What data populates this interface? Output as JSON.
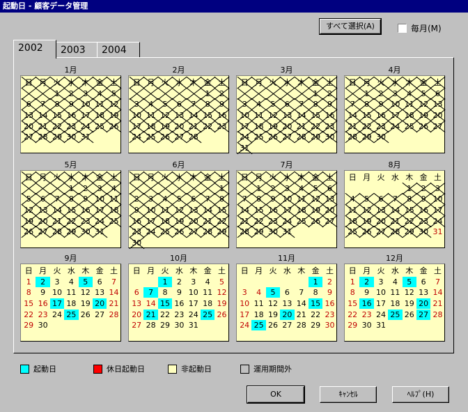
{
  "window": {
    "title": "起動日 - 顧客データ管理"
  },
  "toolbar": {
    "select_all_label": "すべて選択(A)",
    "monthly_label": "毎月(M)"
  },
  "tabs": [
    "2002",
    "2003",
    "2004"
  ],
  "active_tab": "2002",
  "weekday_headers": [
    "日",
    "月",
    "火",
    "水",
    "木",
    "金",
    "土"
  ],
  "months": [
    {
      "title": "1月",
      "start": 2,
      "days": 31,
      "off": true
    },
    {
      "title": "2月",
      "start": 5,
      "days": 28,
      "off": true
    },
    {
      "title": "3月",
      "start": 5,
      "days": 31,
      "off": true
    },
    {
      "title": "4月",
      "start": 1,
      "days": 30,
      "off": true
    },
    {
      "title": "5月",
      "start": 3,
      "days": 31,
      "off": true
    },
    {
      "title": "6月",
      "start": 6,
      "days": 30,
      "off": true
    },
    {
      "title": "7月",
      "start": 1,
      "days": 31,
      "off": true
    },
    {
      "title": "8月",
      "start": 4,
      "days": 31,
      "off_through": 30,
      "holidays": []
    },
    {
      "title": "9月",
      "start": 0,
      "days": 30,
      "cyan": [
        2,
        5,
        17,
        20,
        25
      ],
      "holidays": [
        16,
        23
      ]
    },
    {
      "title": "10月",
      "start": 2,
      "days": 31,
      "cyan": [
        1,
        7,
        15,
        21,
        25
      ],
      "holidays": [
        14
      ]
    },
    {
      "title": "11月",
      "start": 5,
      "days": 30,
      "cyan": [
        1,
        5,
        15,
        20,
        25
      ],
      "holidays": [
        3,
        4,
        23
      ]
    },
    {
      "title": "12月",
      "start": 0,
      "days": 31,
      "cyan": [
        2,
        5,
        16,
        20,
        25,
        27
      ],
      "holidays": [
        23
      ]
    }
  ],
  "legend": [
    {
      "label": "起動日",
      "color": "#00ffff"
    },
    {
      "label": "休日起動日",
      "color": "#ff0000"
    },
    {
      "label": "非起動日",
      "color": "#ffffc0"
    },
    {
      "label": "運用期間外",
      "color": "#c0c0c0"
    }
  ],
  "buttons": {
    "ok": "OK",
    "cancel": "ｷｬﾝｾﾙ",
    "help": "ﾍﾙﾌﾟ(H)"
  }
}
